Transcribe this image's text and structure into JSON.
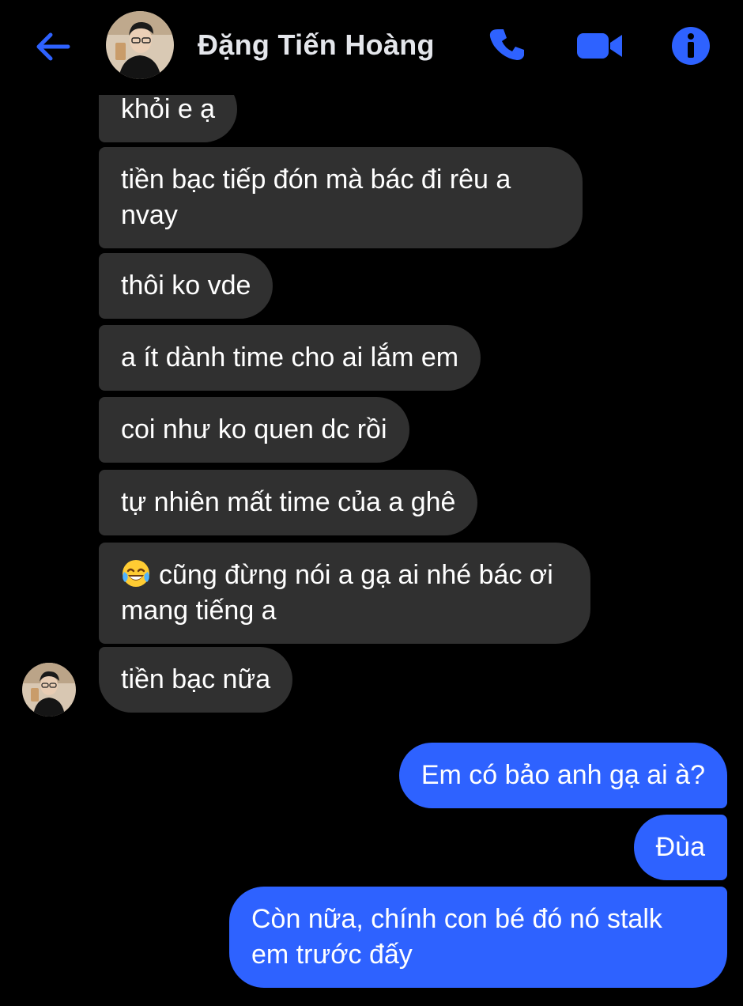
{
  "header": {
    "contact_name": "Đặng Tiến Hoàng",
    "icons": [
      "back-arrow-icon",
      "phone-icon",
      "video-camera-icon",
      "info-icon"
    ],
    "accent_color": "#2e62ff"
  },
  "messages": {
    "incoming": [
      "khỏi e ạ",
      "tiền bạc tiếp đón mà bác đi rêu a nvay",
      "thôi ko vde",
      "a ít dành time cho ai lắm em",
      "coi như ko quen dc rồi",
      "tự nhiên mất time của a ghê",
      "cũng đừng nói a gạ ai nhé bác ơi mang tiếng a",
      "tiền bạc nữa"
    ],
    "outgoing": [
      "Em có bảo anh gạ ai à?",
      "Đùa",
      "Còn nữa, chính con bé đó nó stalk em trước đấy"
    ],
    "emoji": "laughing-tears-emoji-icon"
  },
  "colors": {
    "background": "#000000",
    "incoming_bubble": "#303030",
    "outgoing_bubble": "#2e62ff"
  }
}
